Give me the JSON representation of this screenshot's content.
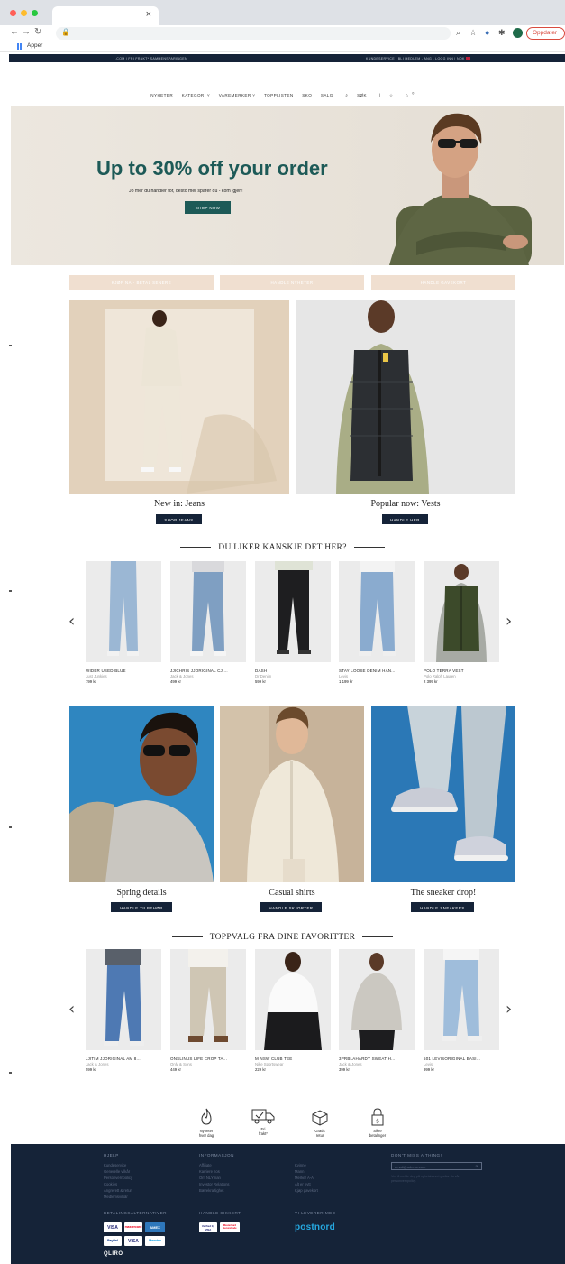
{
  "browser": {
    "bookmarks_label": "Apper",
    "update_label": "Oppdater"
  },
  "topstrip": {
    "left": ".COM  |  FRI FRAKT* SAMMENSPARINGEN",
    "right": "KUNDESERVICE  |  BLI MEDLEM - ANG - LOGG INN  |  NOK"
  },
  "nav": {
    "items": [
      "NYHETER",
      "KATEGORI ˅",
      "VAREMERKER ˅",
      "TOPPLISTEN",
      "SKO",
      "SALG",
      "SØK",
      "|",
      "☆",
      "0"
    ]
  },
  "hero": {
    "title": "Up to 30% off your order",
    "subtitle": "Jo mer du handler for, desto mer sparer du - kom igjen!",
    "button": "SHOP NOW"
  },
  "pills": [
    "KJØP NÅ - BETAL SENERE",
    "HANDLE NYHETER",
    "HANDLE GAVEKORT"
  ],
  "features": [
    {
      "caption": "New in: Jeans",
      "button": "SHOP JEANS"
    },
    {
      "caption": "Popular now: Vests",
      "button": "HANDLE HER"
    }
  ],
  "recommend": {
    "title": "DU LIKER KANSKJE DET HER?",
    "products": [
      {
        "name": "WIDER USED BLUE",
        "brand": "Just Junkies",
        "price": "799 kr"
      },
      {
        "name": "JJICHRIS JJORIGINAL CJ ...",
        "brand": "Jack & Jones",
        "price": "499 kr"
      },
      {
        "name": "DASH",
        "brand": "Dr Denim",
        "price": "599 kr"
      },
      {
        "name": "STAY LOOSE DENIM HAN...",
        "brand": "Levis",
        "price": "1 199 kr"
      },
      {
        "name": "POLO TERRA VEST",
        "brand": "Polo Ralph Lauren",
        "price": "2 399 kr"
      }
    ]
  },
  "categories": [
    {
      "caption": "Spring details",
      "button": "HANDLE TILBEHØR"
    },
    {
      "caption": "Casual shirts",
      "button": "HANDLE SKJORTER"
    },
    {
      "caption": "The sneaker drop!",
      "button": "HANDLE SNEAKERS"
    }
  ],
  "favorites": {
    "title": "TOPPVALG FRA DINE FAVORITTER",
    "products": [
      {
        "name": "JJITIM JJORIGINAL AM 8...",
        "brand": "Jack & Jones",
        "price": "599 kr"
      },
      {
        "name": "ONSLINUS LIFE CROP TA...",
        "brand": "Only & Sons",
        "price": "449 kr"
      },
      {
        "name": "M NSW CLUB TEE",
        "brand": "Nike Sportswear",
        "price": "229 kr"
      },
      {
        "name": "3PRBLAHARDY SWEAT H...",
        "brand": "Jack & Jones",
        "price": "399 kr"
      },
      {
        "name": "501 LEVISORIGINAL BASI...",
        "brand": "Levis",
        "price": "999 kr"
      }
    ]
  },
  "usps": [
    {
      "label": "Nyheter\nhver dag",
      "icon": "flame-icon"
    },
    {
      "label": "Fri\nfrakt*",
      "icon": "delivery-truck-icon"
    },
    {
      "label": "Gratis\nretur",
      "icon": "return-package-icon"
    },
    {
      "label": "Sikre\nbetalinger",
      "icon": "padlock-icon"
    }
  ],
  "footer": {
    "col1_title": "HJELP",
    "col1_links": [
      "Kundeservice",
      "Generelle vilkår",
      "Personvernpolicy",
      "Cookies",
      "Angrerett & retur",
      "Medlemsvilkår"
    ],
    "col2_title": "INFORMASJON",
    "col2_links": [
      "Affiliate",
      "Karriere hos",
      "Om NLYman",
      "Investor Relations",
      "Bærekraftighet"
    ],
    "col3_links": [
      "Kvinne",
      "Mann",
      "Merker A-Å",
      "Alt er nytt",
      "Kjøp gavekort"
    ],
    "newsletter_title": "DON'T MISS A THING!",
    "email_placeholder": "email@adress.com",
    "newsletter_note": "Ved å melde deg på nyhetsbrevet godtar du vår personvernpolicy.",
    "pay_title": "BETALINGSALTERNATIVER",
    "secure_title": "HANDLE SIKKERT",
    "delivery_title": "VI LEVERER MED",
    "payments": [
      "VISA",
      "mastercard",
      "AMEX",
      "PayPal",
      "VISA",
      "Maestro"
    ],
    "secure": [
      "Verified by VISA",
      "MasterCard SecureCode"
    ],
    "delivery_brand": "postnord",
    "qliro": "QLIRO"
  },
  "colors": {
    "brand_green": "#1d5a57",
    "navy": "#152338",
    "pill": "#f0dfd0"
  }
}
